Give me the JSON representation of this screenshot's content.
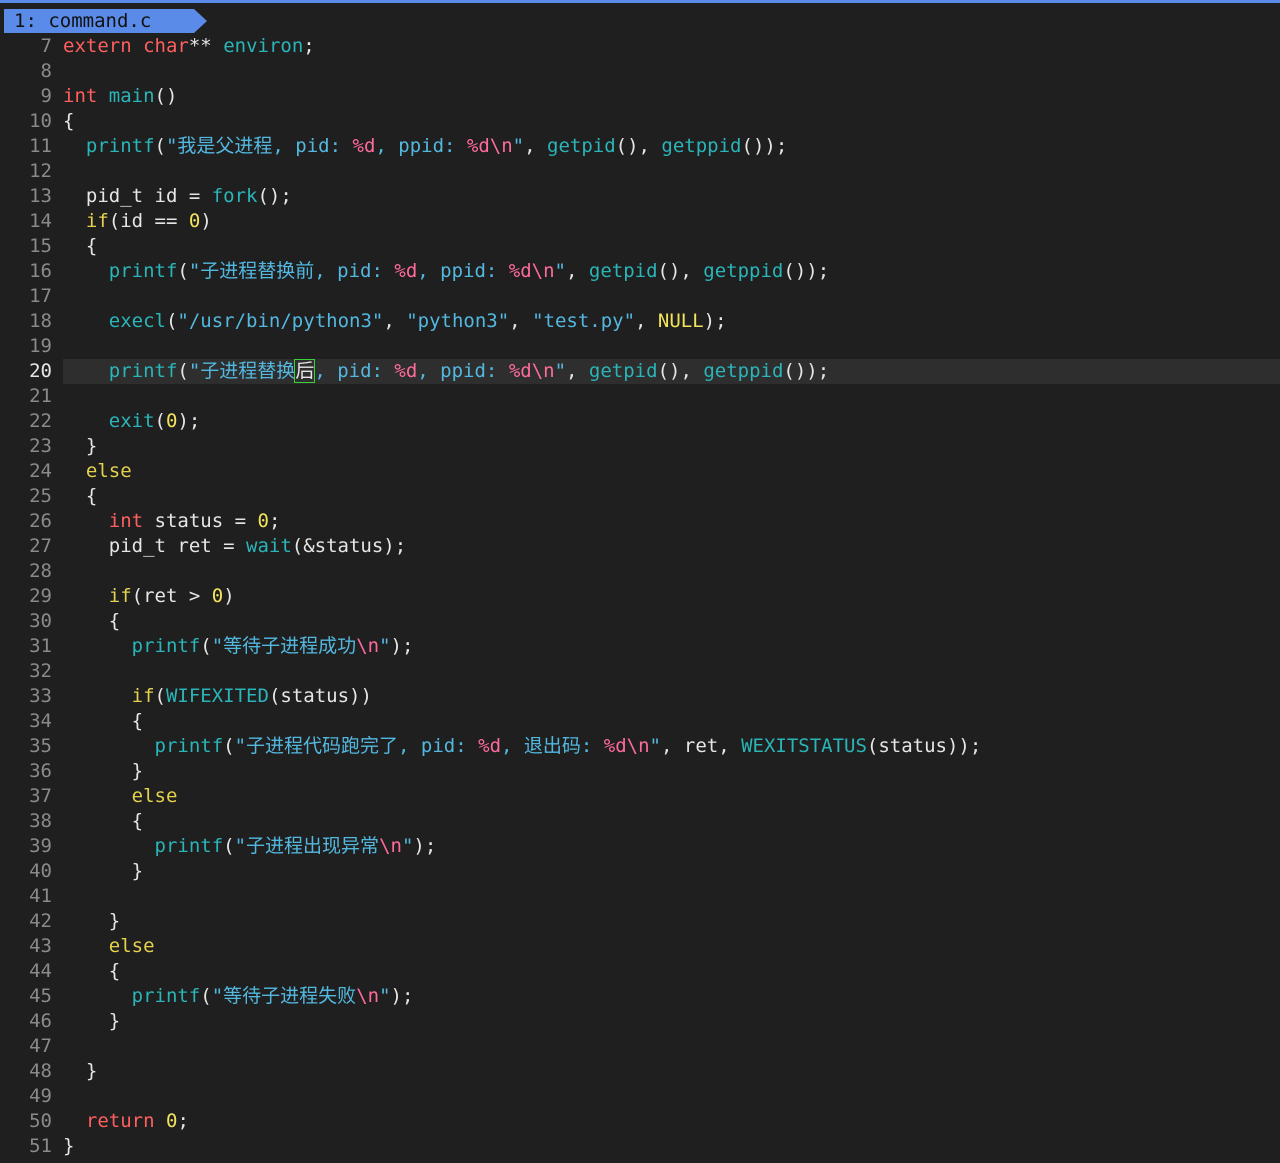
{
  "tab": {
    "label": "1: command.c"
  },
  "current_line": 20,
  "lines": [
    {
      "n": "7",
      "tokens": [
        [
          "kw",
          "extern"
        ],
        [
          "p",
          " "
        ],
        [
          "kw",
          "char"
        ],
        [
          "p",
          "** "
        ],
        [
          "fn",
          "environ"
        ],
        [
          "p",
          ";"
        ]
      ]
    },
    {
      "n": "8",
      "tokens": []
    },
    {
      "n": "9",
      "tokens": [
        [
          "kw",
          "int"
        ],
        [
          "p",
          " "
        ],
        [
          "fn",
          "main"
        ],
        [
          "p",
          "()"
        ]
      ]
    },
    {
      "n": "10",
      "tokens": [
        [
          "p",
          "{"
        ]
      ]
    },
    {
      "n": "11",
      "tokens": [
        [
          "p",
          "  "
        ],
        [
          "fn",
          "printf"
        ],
        [
          "p",
          "("
        ],
        [
          "str",
          "\"我是父进程, pid: "
        ],
        [
          "fmt",
          "%d"
        ],
        [
          "str",
          ", ppid: "
        ],
        [
          "fmt",
          "%d\\n"
        ],
        [
          "str",
          "\""
        ],
        [
          "p",
          ", "
        ],
        [
          "fn",
          "getpid"
        ],
        [
          "p",
          "(), "
        ],
        [
          "fn",
          "getppid"
        ],
        [
          "p",
          "());"
        ]
      ]
    },
    {
      "n": "12",
      "tokens": []
    },
    {
      "n": "13",
      "tokens": [
        [
          "p",
          "  pid_t id = "
        ],
        [
          "fn",
          "fork"
        ],
        [
          "p",
          "();"
        ]
      ]
    },
    {
      "n": "14",
      "tokens": [
        [
          "p",
          "  "
        ],
        [
          "ctl",
          "if"
        ],
        [
          "p",
          "(id == "
        ],
        [
          "num",
          "0"
        ],
        [
          "p",
          ")"
        ]
      ]
    },
    {
      "n": "15",
      "tokens": [
        [
          "p",
          "  {"
        ]
      ]
    },
    {
      "n": "16",
      "tokens": [
        [
          "p",
          "    "
        ],
        [
          "fn",
          "printf"
        ],
        [
          "p",
          "("
        ],
        [
          "str",
          "\"子进程替换前, pid: "
        ],
        [
          "fmt",
          "%d"
        ],
        [
          "str",
          ", ppid: "
        ],
        [
          "fmt",
          "%d\\n"
        ],
        [
          "str",
          "\""
        ],
        [
          "p",
          ", "
        ],
        [
          "fn",
          "getpid"
        ],
        [
          "p",
          "(), "
        ],
        [
          "fn",
          "getppid"
        ],
        [
          "p",
          "());"
        ]
      ]
    },
    {
      "n": "17",
      "tokens": []
    },
    {
      "n": "18",
      "tokens": [
        [
          "p",
          "    "
        ],
        [
          "fn",
          "execl"
        ],
        [
          "p",
          "("
        ],
        [
          "str",
          "\"/usr/bin/python3\""
        ],
        [
          "p",
          ", "
        ],
        [
          "str",
          "\"python3\""
        ],
        [
          "p",
          ", "
        ],
        [
          "str",
          "\"test.py\""
        ],
        [
          "p",
          ", "
        ],
        [
          "const",
          "NULL"
        ],
        [
          "p",
          ");"
        ]
      ]
    },
    {
      "n": "19",
      "tokens": []
    },
    {
      "n": "20",
      "tokens": [
        [
          "p",
          "    "
        ],
        [
          "fn",
          "printf"
        ],
        [
          "p",
          "("
        ],
        [
          "str",
          "\"子进程替换"
        ],
        [
          "cur",
          "后"
        ],
        [
          "str",
          ", pid: "
        ],
        [
          "fmt",
          "%d"
        ],
        [
          "str",
          ", ppid: "
        ],
        [
          "fmt",
          "%d\\n"
        ],
        [
          "str",
          "\""
        ],
        [
          "p",
          ", "
        ],
        [
          "fn",
          "getpid"
        ],
        [
          "p",
          "(), "
        ],
        [
          "fn",
          "getppid"
        ],
        [
          "p",
          "());"
        ]
      ]
    },
    {
      "n": "21",
      "tokens": []
    },
    {
      "n": "22",
      "tokens": [
        [
          "p",
          "    "
        ],
        [
          "fn",
          "exit"
        ],
        [
          "p",
          "("
        ],
        [
          "num",
          "0"
        ],
        [
          "p",
          ");"
        ]
      ]
    },
    {
      "n": "23",
      "tokens": [
        [
          "p",
          "  }"
        ]
      ]
    },
    {
      "n": "24",
      "tokens": [
        [
          "p",
          "  "
        ],
        [
          "ctl",
          "else"
        ]
      ]
    },
    {
      "n": "25",
      "tokens": [
        [
          "p",
          "  {"
        ]
      ]
    },
    {
      "n": "26",
      "tokens": [
        [
          "p",
          "    "
        ],
        [
          "kw",
          "int"
        ],
        [
          "p",
          " status = "
        ],
        [
          "num",
          "0"
        ],
        [
          "p",
          ";"
        ]
      ]
    },
    {
      "n": "27",
      "tokens": [
        [
          "p",
          "    pid_t ret = "
        ],
        [
          "fn",
          "wait"
        ],
        [
          "p",
          "(&status);"
        ]
      ]
    },
    {
      "n": "28",
      "tokens": []
    },
    {
      "n": "29",
      "tokens": [
        [
          "p",
          "    "
        ],
        [
          "ctl",
          "if"
        ],
        [
          "p",
          "(ret > "
        ],
        [
          "num",
          "0"
        ],
        [
          "p",
          ")"
        ]
      ]
    },
    {
      "n": "30",
      "tokens": [
        [
          "p",
          "    {"
        ]
      ]
    },
    {
      "n": "31",
      "tokens": [
        [
          "p",
          "      "
        ],
        [
          "fn",
          "printf"
        ],
        [
          "p",
          "("
        ],
        [
          "str",
          "\"等待子进程成功"
        ],
        [
          "fmt",
          "\\n"
        ],
        [
          "str",
          "\""
        ],
        [
          "p",
          ");"
        ]
      ]
    },
    {
      "n": "32",
      "tokens": []
    },
    {
      "n": "33",
      "tokens": [
        [
          "p",
          "      "
        ],
        [
          "ctl",
          "if"
        ],
        [
          "p",
          "("
        ],
        [
          "macro",
          "WIFEXITED"
        ],
        [
          "p",
          "(status))"
        ]
      ]
    },
    {
      "n": "34",
      "tokens": [
        [
          "p",
          "      {"
        ]
      ]
    },
    {
      "n": "35",
      "tokens": [
        [
          "p",
          "        "
        ],
        [
          "fn",
          "printf"
        ],
        [
          "p",
          "("
        ],
        [
          "str",
          "\"子进程代码跑完了, pid: "
        ],
        [
          "fmt",
          "%d"
        ],
        [
          "str",
          ", 退出码: "
        ],
        [
          "fmt",
          "%d\\n"
        ],
        [
          "str",
          "\""
        ],
        [
          "p",
          ", ret, "
        ],
        [
          "macro",
          "WEXITSTATUS"
        ],
        [
          "p",
          "(status));"
        ]
      ]
    },
    {
      "n": "36",
      "tokens": [
        [
          "p",
          "      }"
        ]
      ]
    },
    {
      "n": "37",
      "tokens": [
        [
          "p",
          "      "
        ],
        [
          "ctl",
          "else"
        ]
      ]
    },
    {
      "n": "38",
      "tokens": [
        [
          "p",
          "      {"
        ]
      ]
    },
    {
      "n": "39",
      "tokens": [
        [
          "p",
          "        "
        ],
        [
          "fn",
          "printf"
        ],
        [
          "p",
          "("
        ],
        [
          "str",
          "\"子进程出现异常"
        ],
        [
          "fmt",
          "\\n"
        ],
        [
          "str",
          "\""
        ],
        [
          "p",
          ");"
        ]
      ]
    },
    {
      "n": "40",
      "tokens": [
        [
          "p",
          "      }"
        ]
      ]
    },
    {
      "n": "41",
      "tokens": []
    },
    {
      "n": "42",
      "tokens": [
        [
          "p",
          "    }"
        ]
      ]
    },
    {
      "n": "43",
      "tokens": [
        [
          "p",
          "    "
        ],
        [
          "ctl",
          "else"
        ]
      ]
    },
    {
      "n": "44",
      "tokens": [
        [
          "p",
          "    {"
        ]
      ]
    },
    {
      "n": "45",
      "tokens": [
        [
          "p",
          "      "
        ],
        [
          "fn",
          "printf"
        ],
        [
          "p",
          "("
        ],
        [
          "str",
          "\"等待子进程失败"
        ],
        [
          "fmt",
          "\\n"
        ],
        [
          "str",
          "\""
        ],
        [
          "p",
          ");"
        ]
      ]
    },
    {
      "n": "46",
      "tokens": [
        [
          "p",
          "    }"
        ]
      ]
    },
    {
      "n": "47",
      "tokens": []
    },
    {
      "n": "48",
      "tokens": [
        [
          "p",
          "  }"
        ]
      ]
    },
    {
      "n": "49",
      "tokens": []
    },
    {
      "n": "50",
      "tokens": [
        [
          "p",
          "  "
        ],
        [
          "kw",
          "return"
        ],
        [
          "p",
          " "
        ],
        [
          "num",
          "0"
        ],
        [
          "p",
          ";"
        ]
      ]
    },
    {
      "n": "51",
      "tokens": [
        [
          "p",
          "}"
        ]
      ]
    }
  ]
}
